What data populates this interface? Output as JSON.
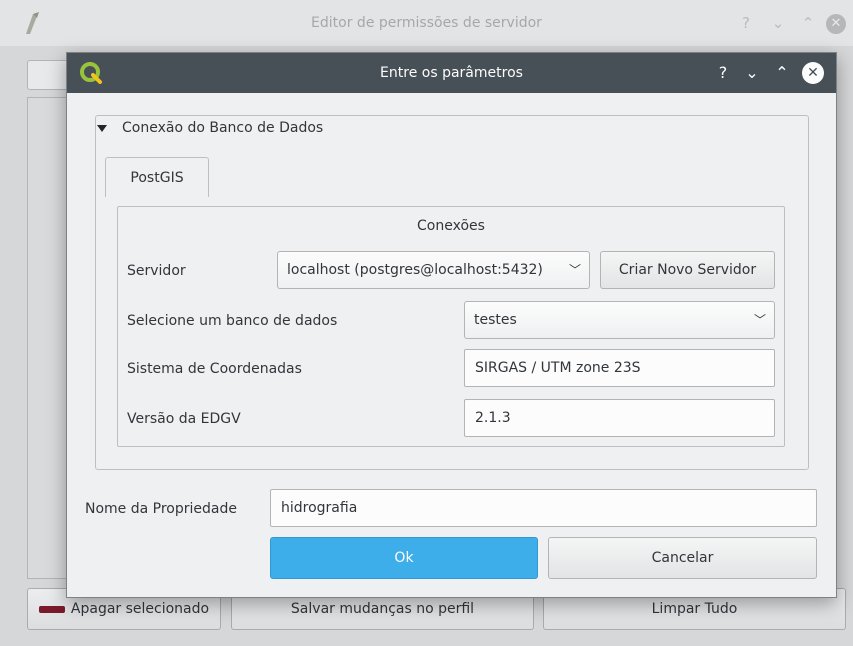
{
  "background_window": {
    "title": "Editor de permissões de servidor",
    "controls": {
      "help": "?",
      "minimize": "⌄",
      "maximize": "⌃",
      "close": "✕"
    },
    "buttons": {
      "delete_selected": "Apagar selecionado",
      "save_profile": "Salvar mudanças no perfil",
      "clear_all": "Limpar Tudo"
    },
    "delete_icon_color": "#7a1a2a"
  },
  "dialog": {
    "title": "Entre os parâmetros",
    "controls": {
      "help": "?",
      "minimize": "⌄",
      "maximize": "⌃",
      "close": "✕"
    },
    "group": {
      "title": "Conexão do Banco de Dados",
      "tabs": [
        {
          "label": "PostGIS",
          "active": true
        }
      ],
      "connections_label": "Conexões",
      "server": {
        "label": "Servidor",
        "value": "localhost (postgres@localhost:5432)",
        "new_server_button": "Criar Novo Servidor"
      },
      "database": {
        "label": "Selecione um banco de dados",
        "value": "testes"
      },
      "crs": {
        "label": "Sistema de Coordenadas",
        "value": "SIRGAS / UTM zone 23S"
      },
      "edgv": {
        "label": "Versão da EDGV",
        "value": "2.1.3"
      }
    },
    "property_name": {
      "label": "Nome da Propriedade",
      "value": "hidrografia"
    },
    "buttons": {
      "ok": "Ok",
      "cancel": "Cancelar"
    }
  },
  "colors": {
    "accent": "#3daee9",
    "titlebar": "#475057"
  }
}
